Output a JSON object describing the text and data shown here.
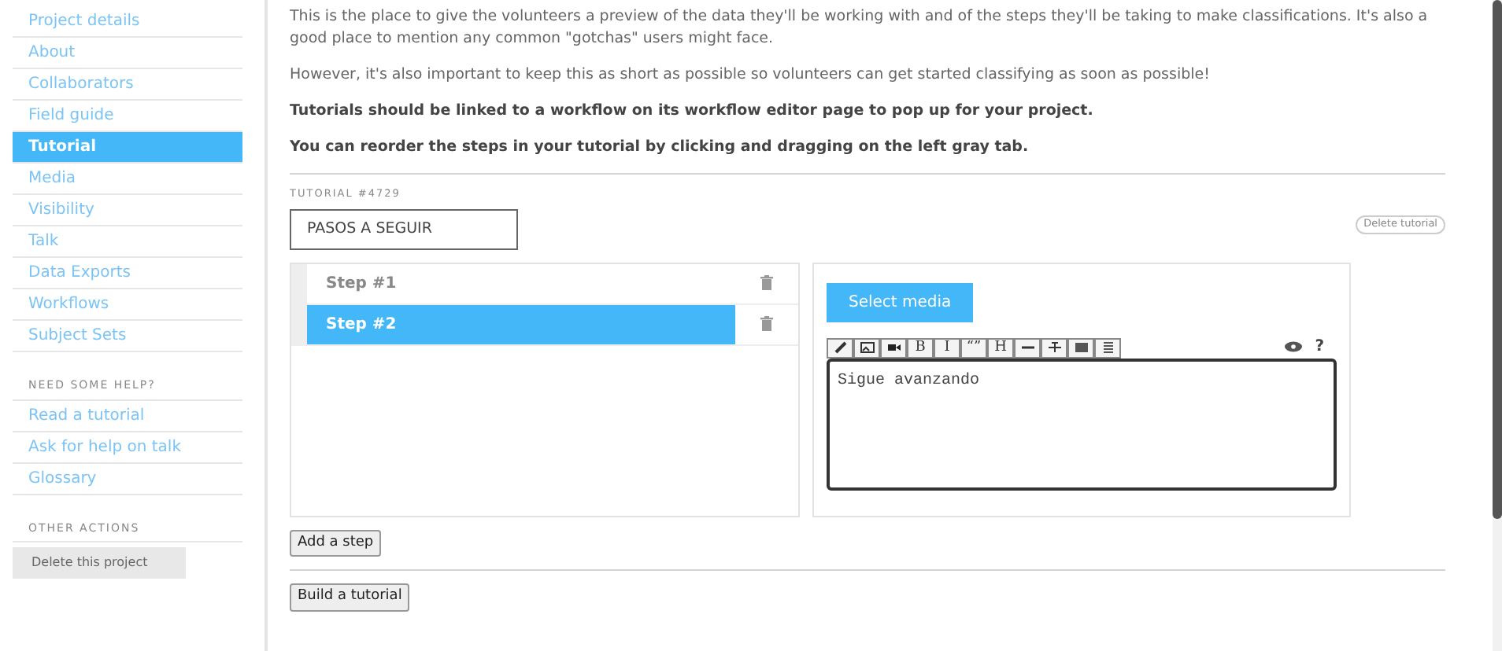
{
  "sidebar": {
    "items": [
      {
        "label": "Project details",
        "selected": false
      },
      {
        "label": "About",
        "selected": false
      },
      {
        "label": "Collaborators",
        "selected": false
      },
      {
        "label": "Field guide",
        "selected": false
      },
      {
        "label": "Tutorial",
        "selected": true
      },
      {
        "label": "Media",
        "selected": false
      },
      {
        "label": "Visibility",
        "selected": false
      },
      {
        "label": "Talk",
        "selected": false
      },
      {
        "label": "Data Exports",
        "selected": false
      },
      {
        "label": "Workflows",
        "selected": false
      },
      {
        "label": "Subject Sets",
        "selected": false
      }
    ],
    "help_heading": "NEED SOME HELP?",
    "help_links": [
      "Read a tutorial",
      "Ask for help on talk",
      "Glossary"
    ],
    "other_heading": "OTHER ACTIONS",
    "delete_project": "Delete this project"
  },
  "intro": [
    {
      "text": "This is the place to give the volunteers a preview of the data they'll be working with and of the steps they'll be taking to make classifications. It's also a good place to mention any common \"gotchas\" users might face.",
      "bold": false
    },
    {
      "text": "However, it's also important to keep this as short as possible so volunteers can get started classifying as soon as possible!",
      "bold": false
    },
    {
      "text": "Tutorials should be linked to a workflow on its workflow editor page to pop up for your project.",
      "bold": true
    },
    {
      "text": "You can reorder the steps in your tutorial by clicking and dragging on the left gray tab.",
      "bold": true
    }
  ],
  "tutorial": {
    "label": "TUTORIAL #4729",
    "name": "PASOS A SEGUIR",
    "delete": "Delete tutorial",
    "steps": [
      {
        "label": "Step #1",
        "selected": false
      },
      {
        "label": "Step #2",
        "selected": true
      }
    ],
    "select_media": "Select media",
    "toolbar": [
      {
        "kind": "link"
      },
      {
        "kind": "image"
      },
      {
        "kind": "video"
      },
      {
        "kind": "text",
        "label": "B"
      },
      {
        "kind": "text",
        "label": "I"
      },
      {
        "kind": "text",
        "label": "“”"
      },
      {
        "kind": "text",
        "label": "H"
      },
      {
        "kind": "hr"
      },
      {
        "kind": "strike"
      },
      {
        "kind": "bullets"
      },
      {
        "kind": "numbers"
      }
    ],
    "help": "?",
    "content": "Sigue avanzando",
    "add_step": "Add a step",
    "build": "Build a tutorial"
  }
}
